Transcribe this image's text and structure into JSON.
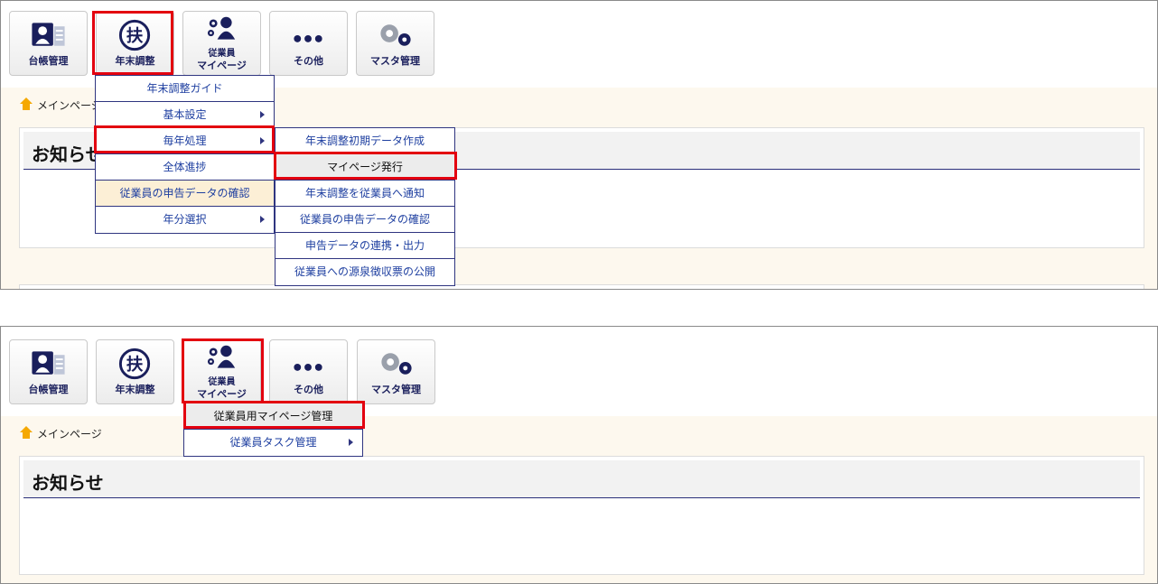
{
  "toolbar": {
    "ledger": "台帳管理",
    "yearend": "年末調整",
    "mypage_line1": "従業員",
    "mypage_line2": "マイページ",
    "other": "その他",
    "master": "マスタ管理"
  },
  "panel1": {
    "breadcrumb": "メインページ",
    "notice_title": "お知らせ",
    "menu": [
      "年末調整ガイド",
      "基本設定",
      "毎年処理",
      "全体進捗",
      "従業員の申告データの確認",
      "年分選択"
    ],
    "submenu": [
      "年末調整初期データ作成",
      "マイページ発行",
      "年末調整を従業員へ通知",
      "従業員の申告データの確認",
      "申告データの連携・出力",
      "従業員への源泉徴収票の公開"
    ]
  },
  "panel2": {
    "breadcrumb": "メインページ",
    "notice_title": "お知らせ",
    "menu": [
      "従業員用マイページ管理",
      "従業員タスク管理"
    ]
  },
  "colors": {
    "highlight": "#e3000f",
    "navy": "#1a1f5c",
    "link": "#1e3fa0",
    "content_bg": "#fdf8ee"
  }
}
